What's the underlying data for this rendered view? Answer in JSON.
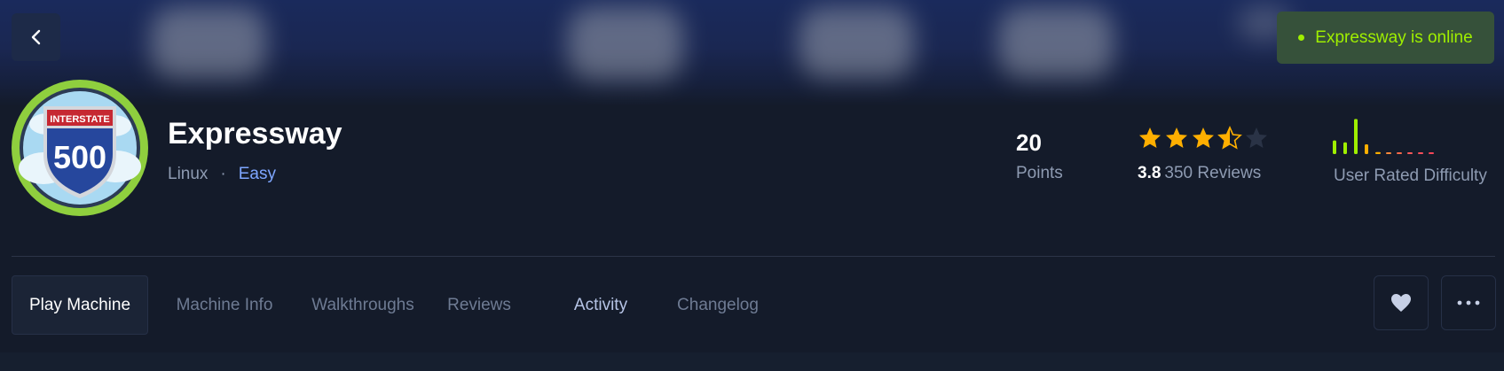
{
  "header": {
    "status": {
      "text": "Expressway is online",
      "color": "#9fef00"
    }
  },
  "machine": {
    "name": "Expressway",
    "os": "Linux",
    "separator": "·",
    "difficulty": "Easy",
    "logo": {
      "sign_label": "INTERSTATE",
      "number": "500",
      "icon": "interstate-sign-icon"
    }
  },
  "stats": {
    "points_value": "20",
    "points_label": "Points",
    "rating_value": "3.8",
    "reviews_label": "350 Reviews",
    "stars": {
      "filled": 3.5,
      "max": 5,
      "color": "#ffaf00"
    },
    "difficulty_label": "User Rated Difficulty",
    "difficulty_bars": [
      0.35,
      0.3,
      0.9,
      0.25,
      0.05,
      0.03,
      0.03,
      0.03,
      0.03,
      0.03
    ]
  },
  "tabs": [
    {
      "label": "Play Machine",
      "active": true
    },
    {
      "label": "Machine Info"
    },
    {
      "label": "Walkthroughs"
    },
    {
      "label": "Reviews"
    },
    {
      "label": "Activity"
    },
    {
      "label": "Changelog"
    }
  ],
  "actions": {
    "favorite_icon": "heart-icon",
    "more_icon": "more-options-icon"
  },
  "colors": {
    "background": "#141b2a",
    "accent_green": "#9fef00",
    "accent_blue": "#7ea6ff"
  }
}
